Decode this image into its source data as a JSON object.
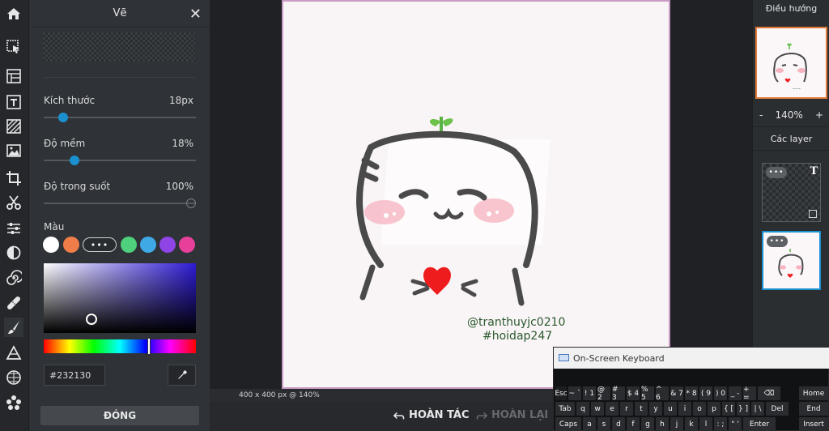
{
  "toolbar": {
    "tools": [
      {
        "name": "home",
        "icon": "home-icon"
      },
      {
        "name": "select",
        "icon": "cursor-arrow-icon"
      },
      {
        "name": "layout",
        "icon": "layout-icon"
      },
      {
        "name": "text",
        "icon": "text-tool-icon"
      },
      {
        "name": "texture",
        "icon": "hatch-pattern-icon"
      },
      {
        "name": "image",
        "icon": "image-icon"
      },
      {
        "name": "crop",
        "icon": "crop-icon"
      },
      {
        "name": "cutout",
        "icon": "scissors-icon"
      },
      {
        "name": "adjust",
        "icon": "sliders-icon"
      },
      {
        "name": "filter",
        "icon": "contrast-icon"
      },
      {
        "name": "liquify",
        "icon": "swirl-icon"
      },
      {
        "name": "healing",
        "icon": "bandage-icon"
      },
      {
        "name": "draw",
        "icon": "brush-icon"
      },
      {
        "name": "shapes",
        "icon": "triangle-icon"
      },
      {
        "name": "pattern",
        "icon": "dots-grid-icon"
      },
      {
        "name": "stickers",
        "icon": "flower-icon"
      }
    ],
    "active_tool": "draw"
  },
  "panel": {
    "title": "Vẽ",
    "size": {
      "label": "Kích thước",
      "value": "18px",
      "fraction": 0.1
    },
    "softness": {
      "label": "Độ mềm",
      "value": "18%",
      "fraction": 0.18
    },
    "opacity": {
      "label": "Độ trong suốt",
      "value": "100%",
      "fraction": 1.0
    },
    "color_label": "Màu",
    "swatches": [
      "#ffffff",
      "#ee7d4a",
      "#4ed07c",
      "#3fa9e6",
      "#8f44e6",
      "#e6409b"
    ],
    "more_swatches_label": "•••",
    "picker_hue_color": "#2d1bd4",
    "hex_value": "#232130",
    "done_label": "ĐÓNG"
  },
  "canvas": {
    "watermark_line1": "@tranthuyjc0210",
    "watermark_line2": "#hoidap247",
    "size_info": "400 x 400 px @ 140%"
  },
  "bottom": {
    "undo_label": "HOÀN TÁC",
    "redo_label": "HOÀN LẠI"
  },
  "right": {
    "navigator_title": "Điều hướng",
    "zoom_minus": "-",
    "zoom_level": "140%",
    "zoom_plus": "+",
    "layers_title": "Các layer",
    "layer_menu_label": "•••",
    "text_layer_icon": "T"
  },
  "osk": {
    "title": "On-Screen Keyboard",
    "rows": [
      [
        "Esc",
        "~ `",
        "! 1",
        "@ 2",
        "# 3",
        "$ 4",
        "% 5",
        "^ 6",
        "& 7",
        "* 8",
        "( 9",
        ") 0",
        "_ -",
        "+ =",
        "⌫"
      ],
      [
        "Tab",
        "q",
        "w",
        "e",
        "r",
        "t",
        "y",
        "u",
        "i",
        "o",
        "p",
        "{ [",
        "} ]",
        "| \\",
        "Del"
      ],
      [
        "Caps",
        "a",
        "s",
        "d",
        "f",
        "g",
        "h",
        "j",
        "k",
        "l",
        ": ;",
        "\" '",
        "Enter"
      ]
    ],
    "side_keys": [
      "Home",
      "End",
      "Insert"
    ]
  }
}
